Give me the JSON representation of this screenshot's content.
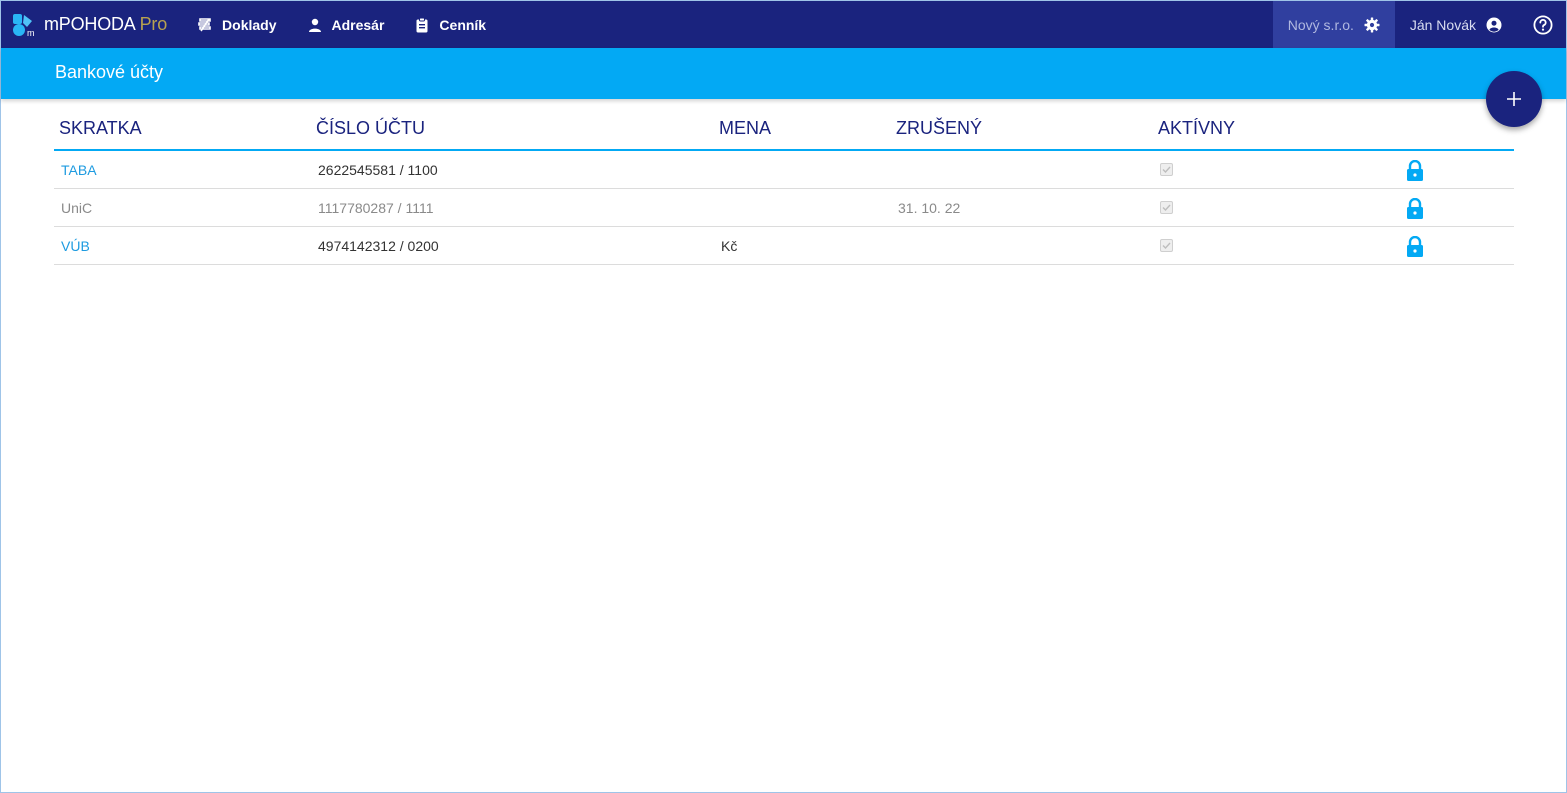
{
  "app": {
    "brand": "mPOHODA",
    "edition": "Pro"
  },
  "nav": [
    {
      "label": "Doklady",
      "icon": "documents-icon"
    },
    {
      "label": "Adresár",
      "icon": "person-icon"
    },
    {
      "label": "Cenník",
      "icon": "clipboard-icon"
    }
  ],
  "header_right": {
    "company": "Nový s.r.o.",
    "user": "Ján Novák"
  },
  "page": {
    "title": "Bankové účty"
  },
  "table": {
    "columns": [
      "SKRATKA",
      "ČÍSLO ÚČTU",
      "MENA",
      "ZRUŠENÝ",
      "AKTÍVNY"
    ],
    "rows": [
      {
        "code": "TABA",
        "account": "2622545581 / 1100",
        "currency": "",
        "cancelled": "",
        "active": true,
        "muted": false
      },
      {
        "code": "UniC",
        "account": "1117780287 / 1111",
        "currency": "",
        "cancelled": "31. 10. 22",
        "active": true,
        "muted": true
      },
      {
        "code": "VÚB",
        "account": "4974142312 / 0200",
        "currency": "Kč",
        "cancelled": "",
        "active": true,
        "muted": false
      }
    ]
  },
  "colors": {
    "primary": "#1a237e",
    "accent": "#03a9f4",
    "link": "#1e9be0"
  }
}
